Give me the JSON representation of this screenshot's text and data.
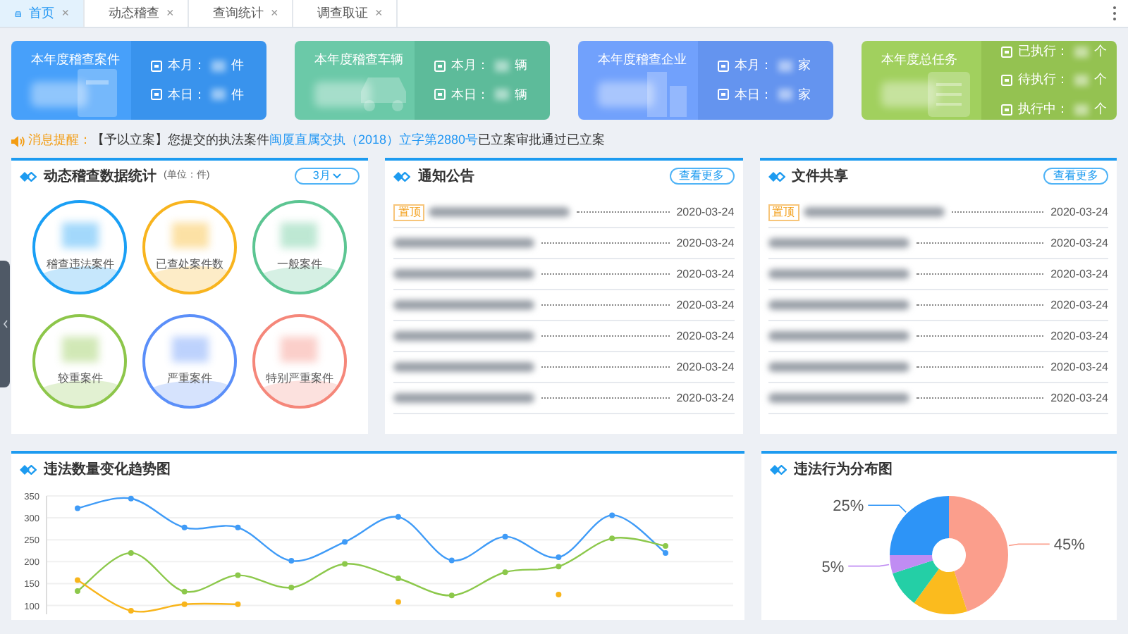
{
  "tabs": [
    {
      "label": "首页",
      "close": "×",
      "selected": true
    },
    {
      "label": "动态稽查",
      "close": "×",
      "selected": false
    },
    {
      "label": "查询统计",
      "close": "×",
      "selected": false
    },
    {
      "label": "调查取证",
      "close": "×",
      "selected": false
    }
  ],
  "summary_cards": [
    {
      "title": "本年度稽查案件",
      "color": "#3d9bfa",
      "stats": [
        {
          "label": "本月：",
          "unit": "件"
        },
        {
          "label": "本日：",
          "unit": "件"
        }
      ]
    },
    {
      "title": "本年度稽查车辆",
      "color": "#63c6a3",
      "stats": [
        {
          "label": "本月：",
          "unit": "辆"
        },
        {
          "label": "本日：",
          "unit": "辆"
        }
      ]
    },
    {
      "title": "本年度稽查企业",
      "color": "#6a9cfc",
      "stats": [
        {
          "label": "本月：",
          "unit": "家"
        },
        {
          "label": "本日：",
          "unit": "家"
        }
      ]
    },
    {
      "title": "本年度总任务",
      "color": "#9ccd56",
      "stats": [
        {
          "label": "已执行：",
          "unit": "个"
        },
        {
          "label": "待执行：",
          "unit": "个"
        },
        {
          "label": "执行中：",
          "unit": "个"
        }
      ]
    }
  ],
  "notice": {
    "label": "消息提醒：",
    "text_before": "【予以立案】您提交的执法案件",
    "link": "闽厦直属交执（2018）立字第2880号",
    "text_after": "已立案审批通过已立案"
  },
  "stats_panel": {
    "title": "动态稽查数据统计",
    "unit": "(单位：件)",
    "month": "3月",
    "circles": [
      {
        "label": "稽查违法案件",
        "color": "#1a9ff5"
      },
      {
        "label": "已查处案件数",
        "color": "#f8b41e"
      },
      {
        "label": "一般案件",
        "color": "#5cc592"
      },
      {
        "label": "较重案件",
        "color": "#8dc64a"
      },
      {
        "label": "严重案件",
        "color": "#5b8ff9"
      },
      {
        "label": "特别严重案件",
        "color": "#f5877a"
      }
    ]
  },
  "notice_panel": {
    "title": "通知公告",
    "more": "查看更多",
    "rows": [
      {
        "tag": "置顶",
        "date": "2020-03-24"
      },
      {
        "date": "2020-03-24"
      },
      {
        "date": "2020-03-24"
      },
      {
        "date": "2020-03-24"
      },
      {
        "date": "2020-03-24"
      },
      {
        "date": "2020-03-24"
      },
      {
        "date": "2020-03-24"
      }
    ]
  },
  "files_panel": {
    "title": "文件共享",
    "more": "查看更多",
    "rows": [
      {
        "tag": "置顶",
        "date": "2020-03-24"
      },
      {
        "date": "2020-03-24"
      },
      {
        "date": "2020-03-24"
      },
      {
        "date": "2020-03-24"
      },
      {
        "date": "2020-03-24"
      },
      {
        "date": "2020-03-24"
      },
      {
        "date": "2020-03-24"
      }
    ]
  },
  "trend_panel": {
    "title": "违法数量变化趋势图",
    "chart_data": {
      "type": "line",
      "ylim": [
        80,
        350
      ],
      "yticks": [
        100,
        150,
        200,
        250,
        300,
        350
      ],
      "grid": true,
      "series": [
        {
          "color": "#3f9bf7",
          "marker": "circle",
          "values": [
            322,
            344,
            278,
            278,
            202,
            245,
            302,
            203,
            257,
            210,
            306,
            220
          ]
        },
        {
          "color": "#8cc84b",
          "marker": "circle",
          "values": [
            133,
            220,
            132,
            169,
            141,
            195,
            162,
            123,
            176,
            189,
            253,
            236
          ]
        },
        {
          "color": "#f8b51c",
          "marker": "circle",
          "values": [
            158,
            88,
            103,
            103,
            null,
            null,
            108,
            null,
            null,
            125,
            null,
            null
          ]
        }
      ]
    }
  },
  "distribution_panel": {
    "title": "违法行为分布图",
    "chart_data": {
      "type": "donut",
      "values": [
        45,
        15,
        10,
        5,
        25
      ],
      "colors": [
        "#fb9e8c",
        "#fbbb1e",
        "#24cfa6",
        "#c08cf3",
        "#2d94f7"
      ],
      "value_labels": [
        "45%",
        null,
        null,
        "5%",
        "25%"
      ]
    }
  }
}
